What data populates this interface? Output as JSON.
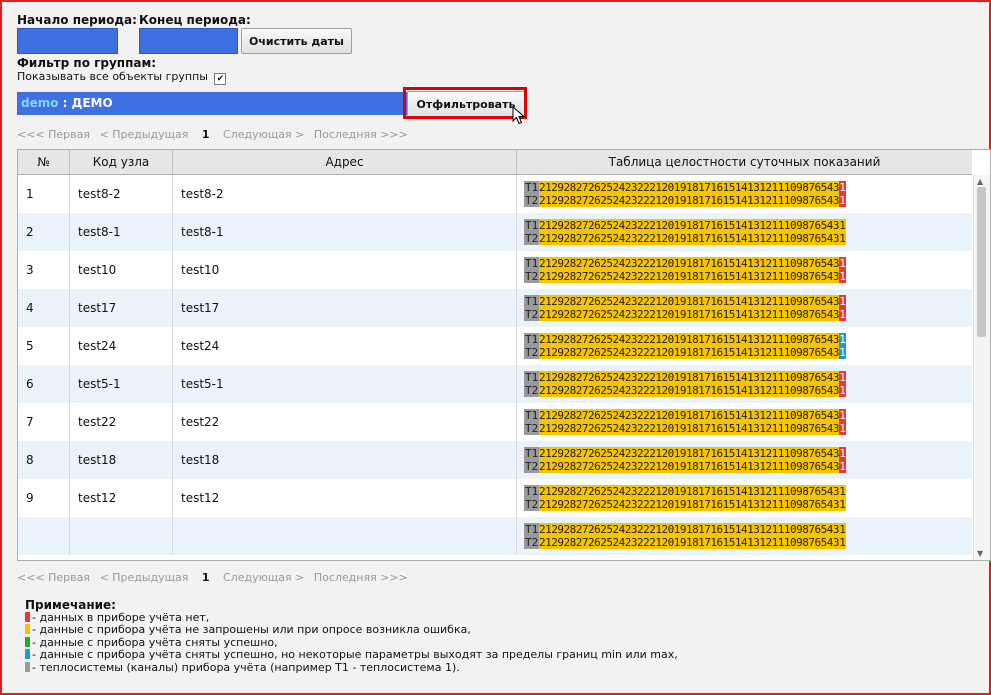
{
  "filters": {
    "start_label": "Начало периода:",
    "end_label": "Конец периода:",
    "clear_dates_label": "Очистить даты",
    "group_filter_label": "Фильтр по группам:",
    "show_all_label": "Показывать все объекты группы",
    "show_all_checked": true,
    "group_code": "demo",
    "group_sep": " : ",
    "group_name": "ДЕМО",
    "filter_button_label": "Отфильтровать"
  },
  "pager": {
    "first": "<<< Первая",
    "prev": "< Предыдущая",
    "current": "1",
    "next": "Следующая >",
    "last": "Последняя >>>"
  },
  "table": {
    "headers": {
      "num": "№",
      "node": "Код узла",
      "address": "Адрес",
      "integrity": "Таблица целостности суточных показаний"
    },
    "strip_days": "2129282726252423222120191817161514131211109876543",
    "strip_t1": "T1",
    "strip_t2": "T2",
    "rows": [
      {
        "num": "1",
        "node": "test8-2",
        "address": "test8-2",
        "t1_end": "1",
        "t1_color": "#e8383d",
        "t2_end": "1",
        "t2_color": "#e8383d"
      },
      {
        "num": "2",
        "node": "test8-1",
        "address": "test8-1",
        "t1_end": "1",
        "t1_color": "#f7c400",
        "t2_end": "1",
        "t2_color": "#f7c400"
      },
      {
        "num": "3",
        "node": "test10",
        "address": "test10",
        "t1_end": "1",
        "t1_color": "#e8383d",
        "t2_end": "1",
        "t2_color": "#e8383d"
      },
      {
        "num": "4",
        "node": "test17",
        "address": "test17",
        "t1_end": "1",
        "t1_color": "#e8383d",
        "t2_end": "1",
        "t2_color": "#e8383d"
      },
      {
        "num": "5",
        "node": "test24",
        "address": "test24",
        "t1_end": "1",
        "t1_color": "#1e9bd7",
        "t2_end": "1",
        "t2_color": "#1e9bd7"
      },
      {
        "num": "6",
        "node": "test5-1",
        "address": "test5-1",
        "t1_end": "1",
        "t1_color": "#e8383d",
        "t2_end": "1",
        "t2_color": "#e8383d"
      },
      {
        "num": "7",
        "node": "test22",
        "address": "test22",
        "t1_end": "1",
        "t1_color": "#e8383d",
        "t2_end": "1",
        "t2_color": "#e8383d"
      },
      {
        "num": "8",
        "node": "test18",
        "address": "test18",
        "t1_end": "1",
        "t1_color": "#e8383d",
        "t2_end": "1",
        "t2_color": "#e8383d"
      },
      {
        "num": "9",
        "node": "test12",
        "address": "test12",
        "t1_end": "1",
        "t1_color": "#f7c400",
        "t2_end": "1",
        "t2_color": "#f7c400"
      },
      {
        "num": "",
        "node": "",
        "address": "",
        "t1_end": "1",
        "t1_color": "#f7c400",
        "t2_end": "1",
        "t2_color": "#f7c400"
      }
    ]
  },
  "notes": {
    "title": "Примечание:",
    "items": [
      {
        "color": "#e8383d",
        "text": "- данных в приборе учёта нет,"
      },
      {
        "color": "#f7c400",
        "text": "- данные с прибора учёта не запрошены или при опросе возникла ошибка,"
      },
      {
        "color": "#22a833",
        "text": "- данные с прибора учёта сняты успешно,"
      },
      {
        "color": "#1e9bd7",
        "text": "- данные с прибора учёта сняты успешно, но некоторые параметры выходят за пределы границ min или max,"
      },
      {
        "color": "#9a9a9a",
        "text": "- теплосистемы (каналы) прибора учёта (например Т1 - теплосистема 1)."
      }
    ]
  }
}
